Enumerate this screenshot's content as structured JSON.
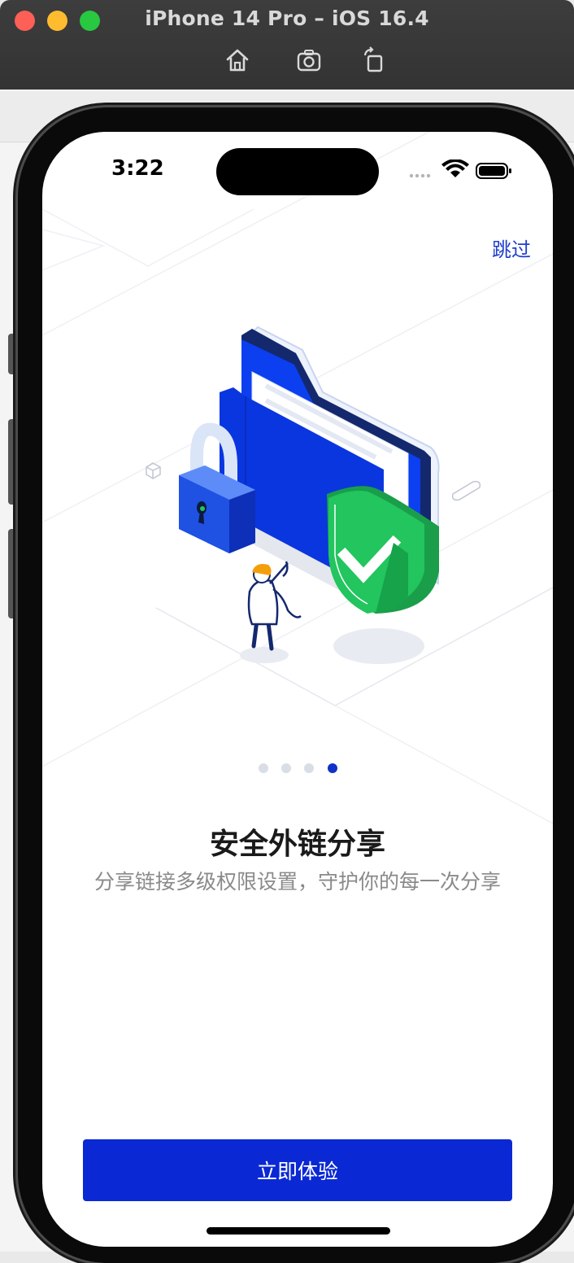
{
  "simulator": {
    "title": "iPhone 14 Pro – iOS 16.4",
    "tools": [
      "home-icon",
      "screenshot-icon",
      "rotate-icon"
    ]
  },
  "status_bar": {
    "time": "3:22",
    "icons": [
      "cellular-icon",
      "wifi-icon",
      "battery-icon"
    ]
  },
  "onboarding": {
    "skip_label": "跳过",
    "page_index": 4,
    "page_count": 4,
    "title": "安全外链分享",
    "subtitle": "分享链接多级权限设置，守护你的每一次分享",
    "cta_label": "立即体验"
  },
  "colors": {
    "accent": "#0a29d4",
    "shield_green": "#22c55e",
    "folder_blue": "#0b3ff0",
    "lock_light": "#9ab6f5"
  }
}
